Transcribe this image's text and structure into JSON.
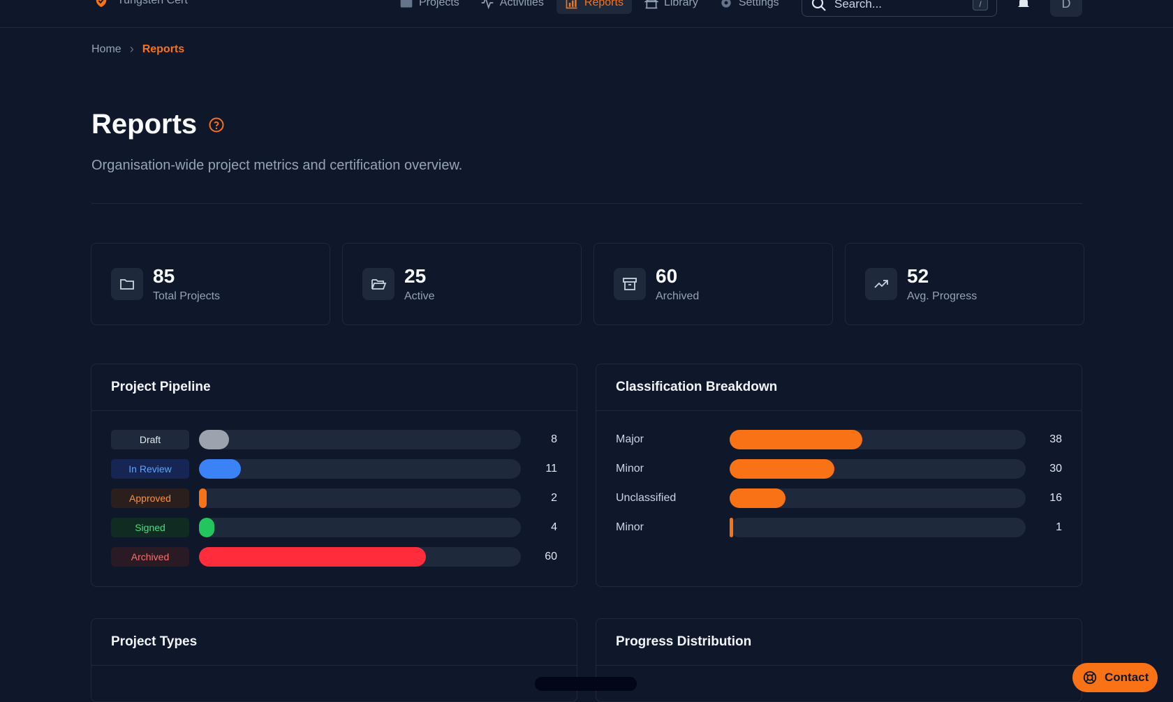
{
  "brand": {
    "name": "Tungsten Cert",
    "accent": "#f97316"
  },
  "nav": [
    {
      "label": "Projects",
      "icon": "folder-icon",
      "active": false
    },
    {
      "label": "Activities",
      "icon": "activity-icon",
      "active": false
    },
    {
      "label": "Reports",
      "icon": "bar-chart-icon",
      "active": true
    },
    {
      "label": "Library",
      "icon": "library-icon",
      "active": false
    },
    {
      "label": "Settings",
      "icon": "gear-icon",
      "active": false
    }
  ],
  "search": {
    "placeholder": "Search...",
    "shortcut": "/"
  },
  "user": {
    "initial": "D"
  },
  "breadcrumb": {
    "home": "Home",
    "current": "Reports"
  },
  "page": {
    "title": "Reports",
    "subtitle": "Organisation-wide project metrics and certification overview."
  },
  "stats": [
    {
      "value": "85",
      "label": "Total Projects",
      "icon": "folder-icon"
    },
    {
      "value": "25",
      "label": "Active",
      "icon": "folder-open-icon"
    },
    {
      "value": "60",
      "label": "Archived",
      "icon": "archive-icon"
    },
    {
      "value": "52",
      "label": "Avg. Progress",
      "icon": "trending-up-icon"
    }
  ],
  "pipeline": {
    "title": "Project Pipeline",
    "max": 85,
    "rows": [
      {
        "label": "Draft",
        "count": 8,
        "color": "#9ca3af",
        "text_color": "#e2e8f0",
        "pill_bg": "#1e293b"
      },
      {
        "label": "In Review",
        "count": 11,
        "color": "#3b82f6",
        "text_color": "#60a5fa",
        "pill_bg": "#172554"
      },
      {
        "label": "Approved",
        "count": 2,
        "color": "#f97316",
        "text_color": "#fb923c",
        "pill_bg": "#2a1f1c"
      },
      {
        "label": "Signed",
        "count": 4,
        "color": "#22c55e",
        "text_color": "#4ade80",
        "pill_bg": "#0f2b22"
      },
      {
        "label": "Archived",
        "count": 60,
        "color": "#ff2d3b",
        "text_color": "#f87171",
        "pill_bg": "#2a1a24"
      }
    ]
  },
  "classification": {
    "title": "Classification Breakdown",
    "max": 85,
    "color": "#f97316",
    "rows": [
      {
        "label": "Major",
        "count": 38
      },
      {
        "label": "Minor",
        "count": 30
      },
      {
        "label": "Unclassified",
        "count": 16
      },
      {
        "label": "Minor",
        "count": 1
      }
    ]
  },
  "lower_panels": {
    "types_title": "Project Types",
    "progress_title": "Progress Distribution"
  },
  "contact": {
    "label": "Contact"
  }
}
